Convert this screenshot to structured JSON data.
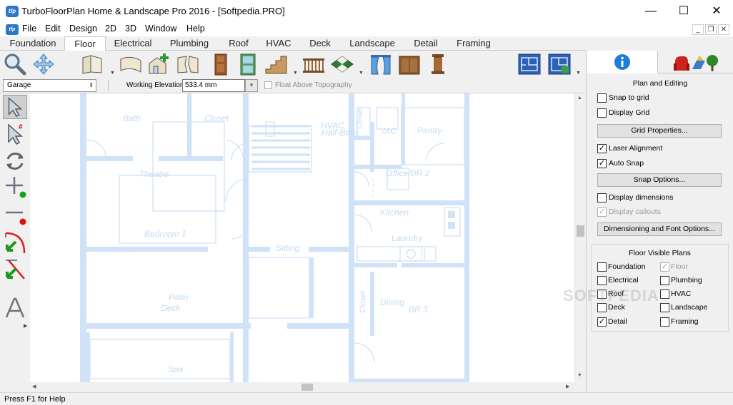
{
  "window": {
    "title": "TurboFloorPlan Home & Landscape Pro 2016 - [Softpedia.PRO]",
    "app_icon_text": "tfp",
    "minimize": "—",
    "maximize": "☐",
    "close": "✕"
  },
  "menu": {
    "items": [
      "File",
      "Edit",
      "Design",
      "2D",
      "3D",
      "Window",
      "Help"
    ],
    "mdi_minimize": "_",
    "mdi_restore": "❐",
    "mdi_close": "✕"
  },
  "tabs": {
    "items": [
      "Foundation",
      "Floor",
      "Electrical",
      "Plumbing",
      "Roof",
      "HVAC",
      "Deck",
      "Landscape",
      "Detail",
      "Framing"
    ],
    "active": "Floor"
  },
  "optbar": {
    "layer": "Garage",
    "elevation_label": "Working Elevation:",
    "elevation_value": "533.4 mm",
    "float_label": "Float Above Topography"
  },
  "plan_labels": {
    "bath": "Bath",
    "closet1": "Closet",
    "hvac": "HVAC",
    "halfbath": "Half-Bath",
    "closet2": "Closet",
    "ac": "/AC",
    "pantry": "Pantry",
    "theatre": "Theatre",
    "office": "Office/BR 2",
    "kitchen": "Kitchen",
    "laundry": "Laundry",
    "bedroom": "Bedroom 1",
    "sitting": "Sitting",
    "patio": "Patio",
    "deck": "Deck",
    "closet3": "Closet",
    "dining": "Dining",
    "br3": "BR 3",
    "spa": "Spa"
  },
  "panel": {
    "section_title": "Plan and Editing",
    "snap_to_grid": "Snap to grid",
    "display_grid": "Display Grid",
    "grid_properties": "Grid Properties...",
    "laser_alignment": "Laser Alignment",
    "auto_snap": "Auto Snap",
    "snap_options": "Snap Options...",
    "display_dimensions": "Display dimensions",
    "display_callouts": "Display callouts",
    "dim_font_options": "Dimensioning and Font Options...",
    "fvp_title": "Floor Visible Plans",
    "fvp": {
      "foundation": "Foundation",
      "floor": "Floor",
      "electrical": "Electrical",
      "plumbing": "Plumbing",
      "roof": "Roof",
      "hvac": "HVAC",
      "deck": "Deck",
      "landscape": "Landscape",
      "detail": "Detail",
      "framing": "Framing"
    },
    "checked_mark": "✓"
  },
  "watermark": "SOFTPEDIA",
  "status": {
    "text": "Press F1 for Help"
  },
  "colors": {
    "plan_wall": "#cfe2f7",
    "plan_text": "#c4dbf4",
    "info_icon": "#1a7fd4"
  }
}
